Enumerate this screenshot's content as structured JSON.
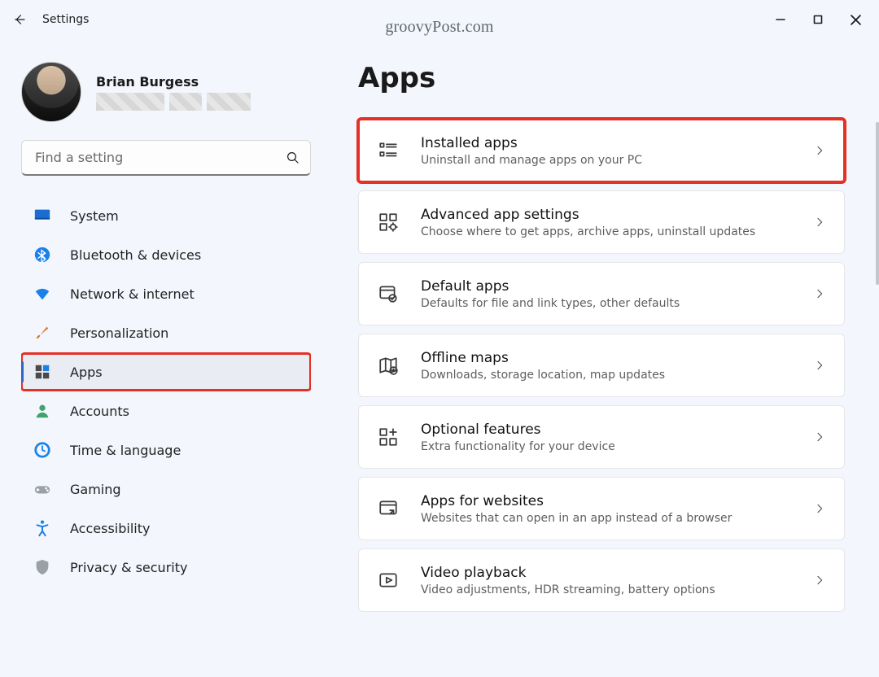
{
  "window": {
    "title": "Settings",
    "watermark": "groovyPost.com"
  },
  "user": {
    "name": "Brian Burgess"
  },
  "search": {
    "placeholder": "Find a setting"
  },
  "sidebar": {
    "items": [
      {
        "label": "System"
      },
      {
        "label": "Bluetooth & devices"
      },
      {
        "label": "Network & internet"
      },
      {
        "label": "Personalization"
      },
      {
        "label": "Apps"
      },
      {
        "label": "Accounts"
      },
      {
        "label": "Time & language"
      },
      {
        "label": "Gaming"
      },
      {
        "label": "Accessibility"
      },
      {
        "label": "Privacy & security"
      }
    ],
    "selected_index": 4,
    "highlighted_index": 4
  },
  "page": {
    "heading": "Apps",
    "highlighted_card_index": 0,
    "cards": [
      {
        "title": "Installed apps",
        "subtitle": "Uninstall and manage apps on your PC"
      },
      {
        "title": "Advanced app settings",
        "subtitle": "Choose where to get apps, archive apps, uninstall updates"
      },
      {
        "title": "Default apps",
        "subtitle": "Defaults for file and link types, other defaults"
      },
      {
        "title": "Offline maps",
        "subtitle": "Downloads, storage location, map updates"
      },
      {
        "title": "Optional features",
        "subtitle": "Extra functionality for your device"
      },
      {
        "title": "Apps for websites",
        "subtitle": "Websites that can open in an app instead of a browser"
      },
      {
        "title": "Video playback",
        "subtitle": "Video adjustments, HDR streaming, battery options"
      }
    ]
  }
}
